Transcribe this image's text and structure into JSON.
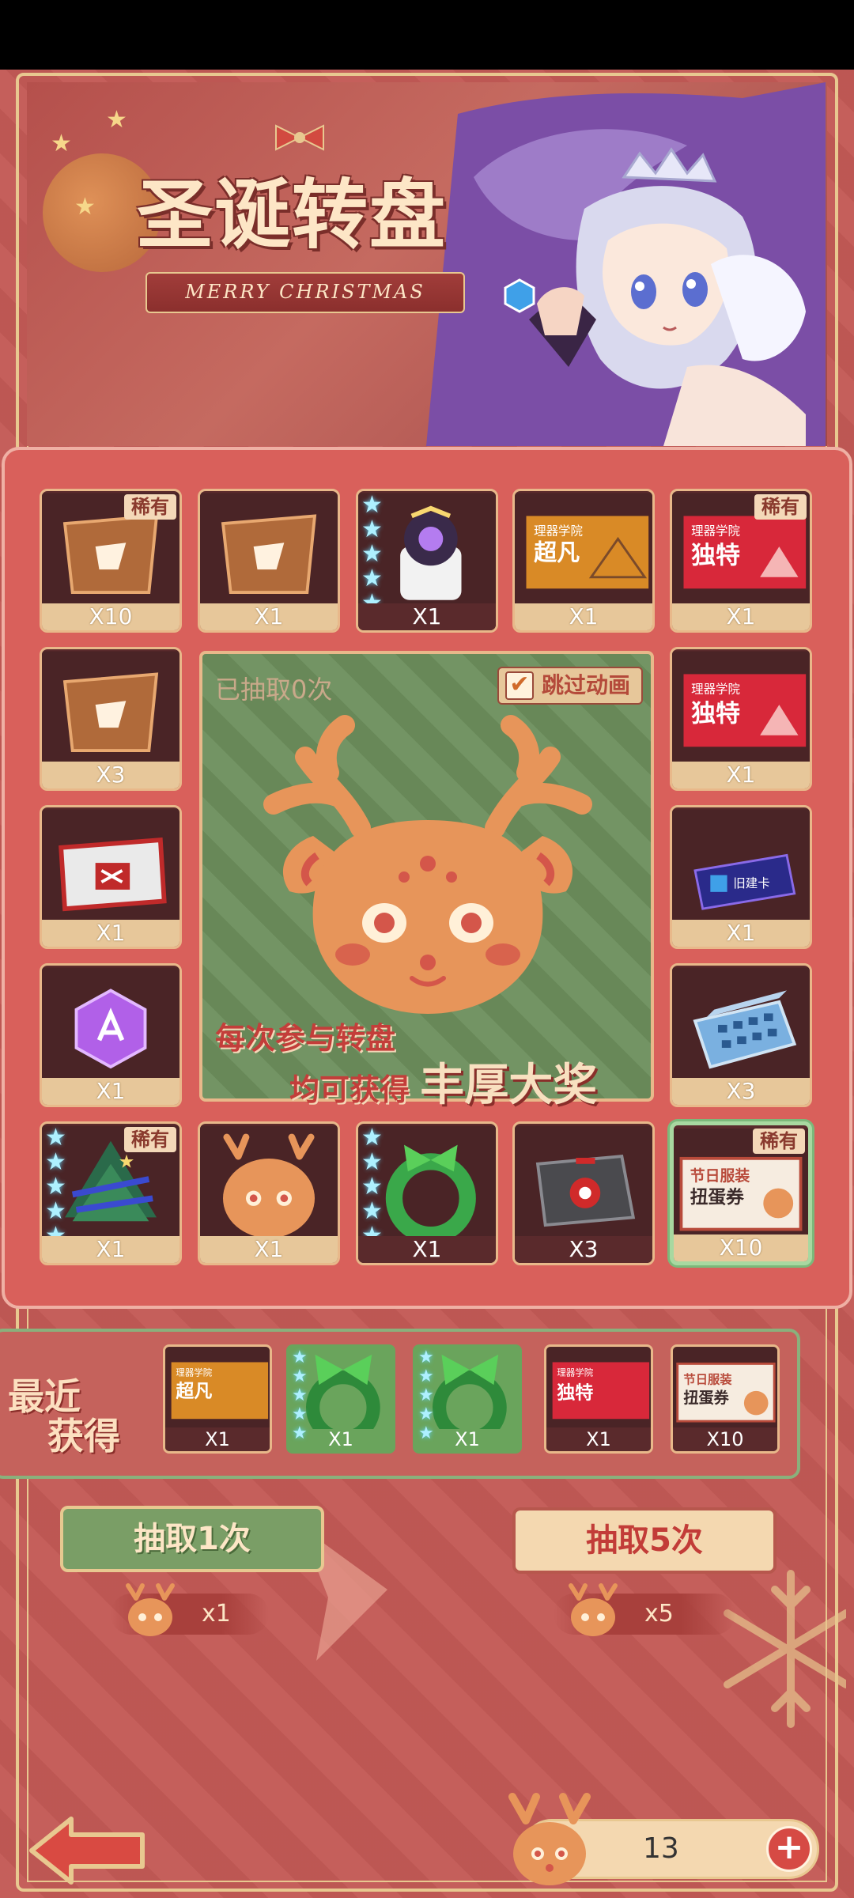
{
  "banner": {
    "title": "圣诞转盘",
    "subtitle": "MERRY CHRISTMAS"
  },
  "grid": {
    "items": [
      {
        "name": "board-fragment",
        "count": "X10",
        "rare": "稀有",
        "rare_tag": true
      },
      {
        "name": "board-fragment",
        "count": "X1",
        "rare": "",
        "rare_tag": false
      },
      {
        "name": "mecha-robot",
        "count": "X1",
        "rare": "",
        "rare_tag": false,
        "stars": 5
      },
      {
        "name": "ticket-chaofan",
        "count": "X1",
        "ticket_school": "理器学院",
        "ticket_label": "超凡"
      },
      {
        "name": "ticket-dute",
        "count": "X1",
        "rare": "稀有",
        "rare_tag": true,
        "ticket_school": "理器学院",
        "ticket_label": "独特"
      },
      {
        "name": "board-fragment",
        "count": "X3"
      },
      {
        "name": "ticket-dute",
        "count": "X1",
        "ticket_school": "理器学院",
        "ticket_label": "独特"
      },
      {
        "name": "shuffle-box",
        "count": "X1"
      },
      {
        "name": "blue-card",
        "count": "X1",
        "card_label": "旧建卡"
      },
      {
        "name": "purple-crystal",
        "count": "X1"
      },
      {
        "name": "chip-case",
        "count": "X3"
      },
      {
        "name": "christmas-tree",
        "count": "X1",
        "rare": "稀有",
        "rare_tag": true,
        "stars": 5
      },
      {
        "name": "reindeer-token",
        "count": "X1"
      },
      {
        "name": "green-wreath",
        "count": "X1",
        "stars": 5
      },
      {
        "name": "metal-crate",
        "count": "X3"
      },
      {
        "name": "costume-coupon",
        "count": "X10",
        "rare": "稀有",
        "rare_tag": true,
        "coupon_line1": "节日服装",
        "coupon_line2": "扭蛋券"
      }
    ]
  },
  "center": {
    "draw_count": "已抽取0次",
    "skip_animation": "跳过动画",
    "line1": "每次参与转盘",
    "line2": "均可获得",
    "line2_big": "丰厚大奖"
  },
  "recent": {
    "label_line1": "最近",
    "label_line2": "获得",
    "items": [
      {
        "name": "ticket-chaofan",
        "count": "X1",
        "label": "超凡",
        "school": "理器学院"
      },
      {
        "name": "green-wreath",
        "count": "X1"
      },
      {
        "name": "green-wreath",
        "count": "X1"
      },
      {
        "name": "ticket-dute",
        "count": "X1",
        "label": "独特",
        "school": "理器学院"
      },
      {
        "name": "costume-coupon",
        "count": "X10",
        "line1": "节日服装",
        "line2": "扭蛋券"
      }
    ]
  },
  "actions": {
    "draw_one": "抽取1次",
    "draw_five": "抽取5次",
    "cost_one": "x1",
    "cost_five": "x5"
  },
  "balance": {
    "amount": "13"
  },
  "colors": {
    "background": "#c35a56",
    "gold_border": "#e8c890",
    "green_panel": "#6c8e5c",
    "cell_bg": "#5a2a2c",
    "deer_orange": "#e7955a"
  }
}
